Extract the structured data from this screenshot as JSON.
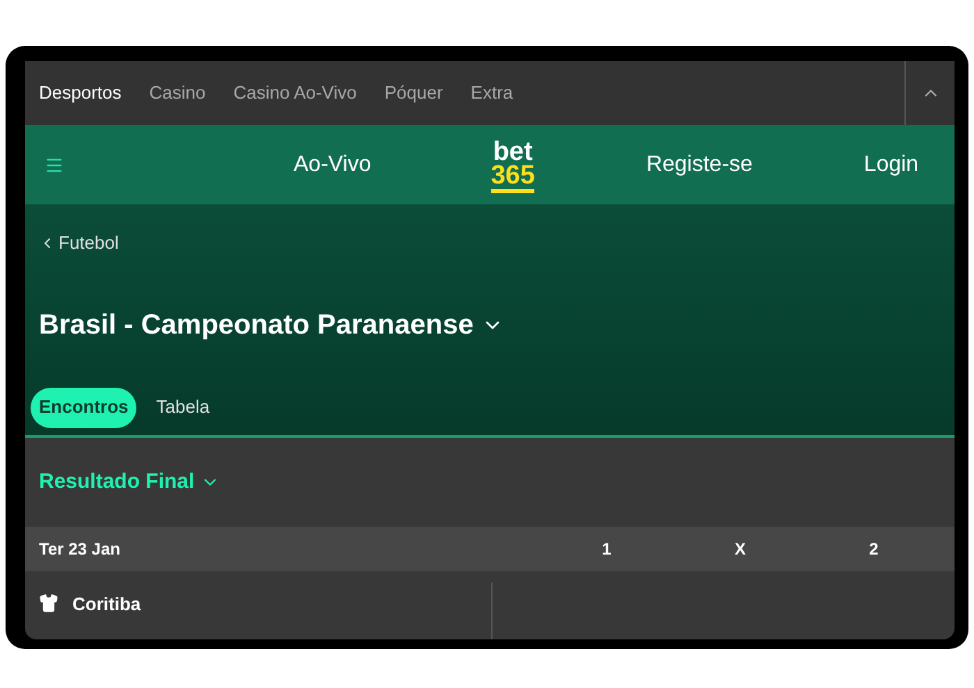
{
  "top_tabs": [
    {
      "label": "Desportos",
      "selected": true
    },
    {
      "label": "Casino",
      "selected": false
    },
    {
      "label": "Casino Ao-Vivo",
      "selected": false
    },
    {
      "label": "Póquer",
      "selected": false
    },
    {
      "label": "Extra",
      "selected": false
    }
  ],
  "nav": {
    "links": [
      "Ao-Vivo",
      "Registe-se",
      "Login"
    ],
    "logo": [
      "bet",
      "365"
    ]
  },
  "breadcrumb": "Futebol",
  "title": "Brasil - Campeonato Paranaense",
  "sub_tabs": [
    {
      "label": "Encontros",
      "selected": true
    },
    {
      "label": "Tabela",
      "selected": false
    }
  ],
  "market": "Resultado Final",
  "table": {
    "date": "Ter 23 Jan",
    "columns": [
      "1",
      "X",
      "2"
    ],
    "rows": [
      {
        "team": "Coritiba"
      }
    ]
  }
}
